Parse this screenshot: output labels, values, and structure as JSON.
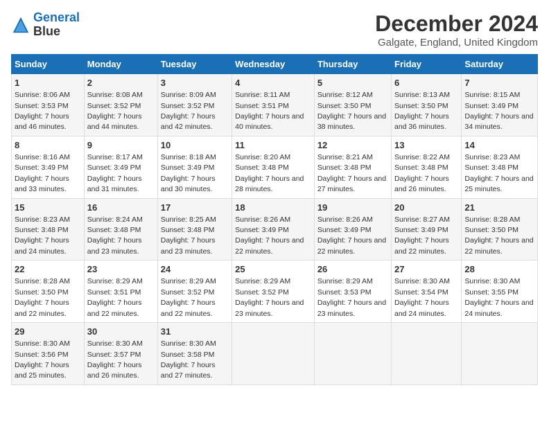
{
  "header": {
    "logo_line1": "General",
    "logo_line2": "Blue",
    "title": "December 2024",
    "subtitle": "Galgate, England, United Kingdom"
  },
  "weekdays": [
    "Sunday",
    "Monday",
    "Tuesday",
    "Wednesday",
    "Thursday",
    "Friday",
    "Saturday"
  ],
  "weeks": [
    [
      {
        "day": "1",
        "sunrise": "Sunrise: 8:06 AM",
        "sunset": "Sunset: 3:53 PM",
        "daylight": "Daylight: 7 hours and 46 minutes."
      },
      {
        "day": "2",
        "sunrise": "Sunrise: 8:08 AM",
        "sunset": "Sunset: 3:52 PM",
        "daylight": "Daylight: 7 hours and 44 minutes."
      },
      {
        "day": "3",
        "sunrise": "Sunrise: 8:09 AM",
        "sunset": "Sunset: 3:52 PM",
        "daylight": "Daylight: 7 hours and 42 minutes."
      },
      {
        "day": "4",
        "sunrise": "Sunrise: 8:11 AM",
        "sunset": "Sunset: 3:51 PM",
        "daylight": "Daylight: 7 hours and 40 minutes."
      },
      {
        "day": "5",
        "sunrise": "Sunrise: 8:12 AM",
        "sunset": "Sunset: 3:50 PM",
        "daylight": "Daylight: 7 hours and 38 minutes."
      },
      {
        "day": "6",
        "sunrise": "Sunrise: 8:13 AM",
        "sunset": "Sunset: 3:50 PM",
        "daylight": "Daylight: 7 hours and 36 minutes."
      },
      {
        "day": "7",
        "sunrise": "Sunrise: 8:15 AM",
        "sunset": "Sunset: 3:49 PM",
        "daylight": "Daylight: 7 hours and 34 minutes."
      }
    ],
    [
      {
        "day": "8",
        "sunrise": "Sunrise: 8:16 AM",
        "sunset": "Sunset: 3:49 PM",
        "daylight": "Daylight: 7 hours and 33 minutes."
      },
      {
        "day": "9",
        "sunrise": "Sunrise: 8:17 AM",
        "sunset": "Sunset: 3:49 PM",
        "daylight": "Daylight: 7 hours and 31 minutes."
      },
      {
        "day": "10",
        "sunrise": "Sunrise: 8:18 AM",
        "sunset": "Sunset: 3:49 PM",
        "daylight": "Daylight: 7 hours and 30 minutes."
      },
      {
        "day": "11",
        "sunrise": "Sunrise: 8:20 AM",
        "sunset": "Sunset: 3:48 PM",
        "daylight": "Daylight: 7 hours and 28 minutes."
      },
      {
        "day": "12",
        "sunrise": "Sunrise: 8:21 AM",
        "sunset": "Sunset: 3:48 PM",
        "daylight": "Daylight: 7 hours and 27 minutes."
      },
      {
        "day": "13",
        "sunrise": "Sunrise: 8:22 AM",
        "sunset": "Sunset: 3:48 PM",
        "daylight": "Daylight: 7 hours and 26 minutes."
      },
      {
        "day": "14",
        "sunrise": "Sunrise: 8:23 AM",
        "sunset": "Sunset: 3:48 PM",
        "daylight": "Daylight: 7 hours and 25 minutes."
      }
    ],
    [
      {
        "day": "15",
        "sunrise": "Sunrise: 8:23 AM",
        "sunset": "Sunset: 3:48 PM",
        "daylight": "Daylight: 7 hours and 24 minutes."
      },
      {
        "day": "16",
        "sunrise": "Sunrise: 8:24 AM",
        "sunset": "Sunset: 3:48 PM",
        "daylight": "Daylight: 7 hours and 23 minutes."
      },
      {
        "day": "17",
        "sunrise": "Sunrise: 8:25 AM",
        "sunset": "Sunset: 3:48 PM",
        "daylight": "Daylight: 7 hours and 23 minutes."
      },
      {
        "day": "18",
        "sunrise": "Sunrise: 8:26 AM",
        "sunset": "Sunset: 3:49 PM",
        "daylight": "Daylight: 7 hours and 22 minutes."
      },
      {
        "day": "19",
        "sunrise": "Sunrise: 8:26 AM",
        "sunset": "Sunset: 3:49 PM",
        "daylight": "Daylight: 7 hours and 22 minutes."
      },
      {
        "day": "20",
        "sunrise": "Sunrise: 8:27 AM",
        "sunset": "Sunset: 3:49 PM",
        "daylight": "Daylight: 7 hours and 22 minutes."
      },
      {
        "day": "21",
        "sunrise": "Sunrise: 8:28 AM",
        "sunset": "Sunset: 3:50 PM",
        "daylight": "Daylight: 7 hours and 22 minutes."
      }
    ],
    [
      {
        "day": "22",
        "sunrise": "Sunrise: 8:28 AM",
        "sunset": "Sunset: 3:50 PM",
        "daylight": "Daylight: 7 hours and 22 minutes."
      },
      {
        "day": "23",
        "sunrise": "Sunrise: 8:29 AM",
        "sunset": "Sunset: 3:51 PM",
        "daylight": "Daylight: 7 hours and 22 minutes."
      },
      {
        "day": "24",
        "sunrise": "Sunrise: 8:29 AM",
        "sunset": "Sunset: 3:52 PM",
        "daylight": "Daylight: 7 hours and 22 minutes."
      },
      {
        "day": "25",
        "sunrise": "Sunrise: 8:29 AM",
        "sunset": "Sunset: 3:52 PM",
        "daylight": "Daylight: 7 hours and 23 minutes."
      },
      {
        "day": "26",
        "sunrise": "Sunrise: 8:29 AM",
        "sunset": "Sunset: 3:53 PM",
        "daylight": "Daylight: 7 hours and 23 minutes."
      },
      {
        "day": "27",
        "sunrise": "Sunrise: 8:30 AM",
        "sunset": "Sunset: 3:54 PM",
        "daylight": "Daylight: 7 hours and 24 minutes."
      },
      {
        "day": "28",
        "sunrise": "Sunrise: 8:30 AM",
        "sunset": "Sunset: 3:55 PM",
        "daylight": "Daylight: 7 hours and 24 minutes."
      }
    ],
    [
      {
        "day": "29",
        "sunrise": "Sunrise: 8:30 AM",
        "sunset": "Sunset: 3:56 PM",
        "daylight": "Daylight: 7 hours and 25 minutes."
      },
      {
        "day": "30",
        "sunrise": "Sunrise: 8:30 AM",
        "sunset": "Sunset: 3:57 PM",
        "daylight": "Daylight: 7 hours and 26 minutes."
      },
      {
        "day": "31",
        "sunrise": "Sunrise: 8:30 AM",
        "sunset": "Sunset: 3:58 PM",
        "daylight": "Daylight: 7 hours and 27 minutes."
      },
      {
        "day": "",
        "sunrise": "",
        "sunset": "",
        "daylight": ""
      },
      {
        "day": "",
        "sunrise": "",
        "sunset": "",
        "daylight": ""
      },
      {
        "day": "",
        "sunrise": "",
        "sunset": "",
        "daylight": ""
      },
      {
        "day": "",
        "sunrise": "",
        "sunset": "",
        "daylight": ""
      }
    ]
  ]
}
